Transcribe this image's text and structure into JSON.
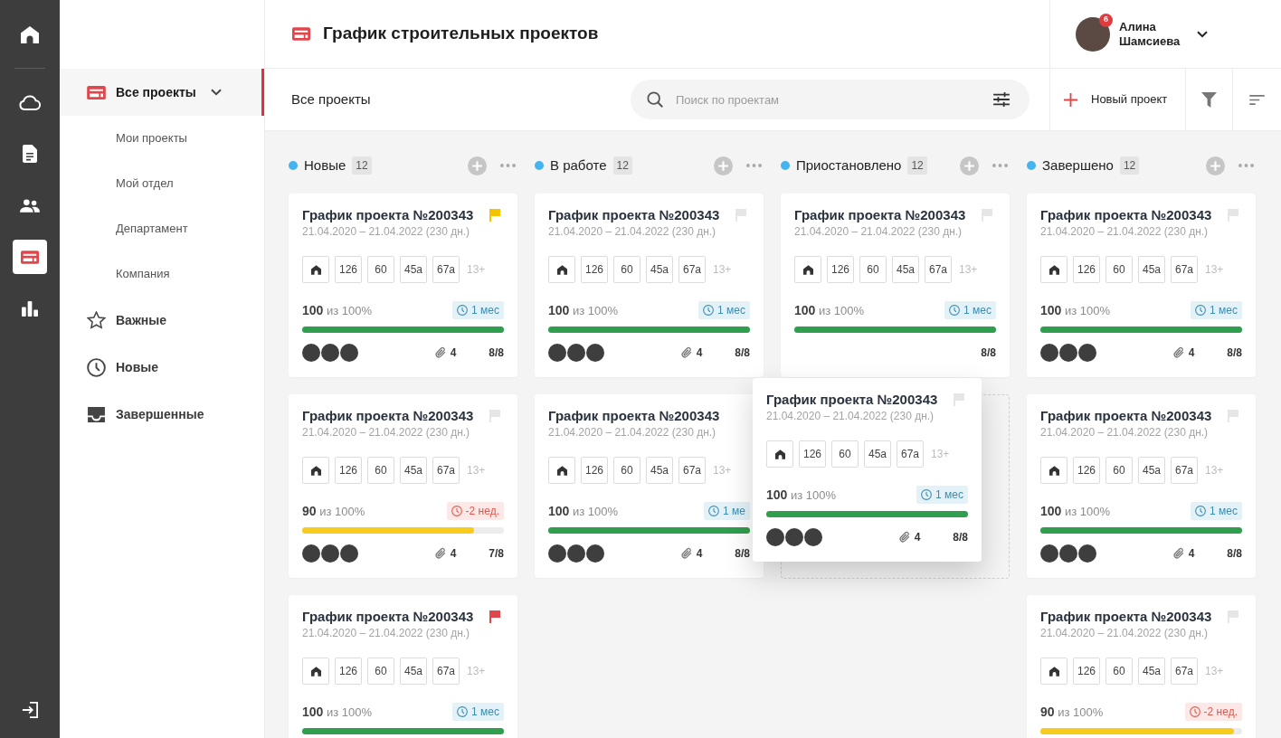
{
  "rail": {
    "items": [
      {
        "selected": false
      },
      {
        "selected": false
      },
      {
        "selected": false
      },
      {
        "selected": false
      },
      {
        "selected": true
      },
      {
        "selected": false
      }
    ]
  },
  "sidebar": {
    "items": [
      {
        "label": "Все проекты",
        "selected": true,
        "expanded": true,
        "children": [
          {
            "label": "Мои проекты",
            "selected": false
          },
          {
            "label": "Мой отдел",
            "selected": false
          },
          {
            "label": "Департамент",
            "selected": false
          },
          {
            "label": "Компания",
            "selected": false
          }
        ]
      },
      {
        "label": "Важные",
        "selected": false
      },
      {
        "label": "Новые",
        "selected": false
      },
      {
        "label": "Завершенные",
        "selected": false
      }
    ]
  },
  "header": {
    "title": "График строительных проектов",
    "user": {
      "name": "Алина Шамсиева",
      "notifications": "6"
    }
  },
  "toolbar": {
    "title": "Все проекты",
    "search": {
      "placeholder": "Поиск по проектам"
    },
    "new_project": "Новый проект"
  },
  "board": {
    "columns": [
      {
        "title": "Новые",
        "count": "12",
        "cards": [
          {
            "kind": "project",
            "title": "График проекта №200343",
            "dates": "21.04.2020 – 21.04.2022 (230 дн.)",
            "flag": {
              "color": "#f5c400"
            },
            "objects": [
              "126",
              "60",
              "45а",
              "67а"
            ],
            "more": "13+",
            "progress": "**100** из 100%",
            "due": {
              "text": "1 мес",
              "late": false
            },
            "level": 1,
            "members": [
              {
                "kind": "photo"
              },
              {
                "kind": "photo"
              },
              {
                "kind": "photo"
              }
            ],
            "attachments": "4",
            "tasks": "8/8"
          },
          {
            "kind": "project",
            "title": "График проекта №200343",
            "dates": "21.04.2020 – 21.04.2022 (230 дн.)",
            "flag": {
              "color": "#e6e6e6"
            },
            "objects": [
              "126",
              "60",
              "45а",
              "67а"
            ],
            "more": "13+",
            "progress": "**90** из 100%",
            "due": {
              "text": "-2 нед.",
              "late": true
            },
            "level": 0.85,
            "members": [
              {
                "kind": "photo"
              },
              {
                "kind": "photo"
              },
              {
                "kind": "photo"
              }
            ],
            "attachments": "4",
            "tasks": "7/8"
          },
          {
            "kind": "project",
            "title": "График проекта №200343",
            "dates": "21.04.2020 – 21.04.2022 (230 дн.)",
            "flag": {
              "color": "#e0474c"
            },
            "objects": [
              "126",
              "60",
              "45а",
              "67а"
            ],
            "more": "13+",
            "progress": "**100** из 100%",
            "due": {
              "text": "1 мес",
              "late": false
            },
            "level": 1
          }
        ]
      },
      {
        "title": "В работе",
        "count": "12",
        "cards": [
          {
            "kind": "project",
            "title": "График проекта №200343",
            "dates": "21.04.2020 – 21.04.2022 (230 дн.)",
            "flag": {
              "color": "#e6e6e6"
            },
            "objects": [
              "126",
              "60",
              "45а",
              "67а"
            ],
            "more": "13+",
            "progress": "**100** из 100%",
            "due": {
              "text": "1 мес",
              "late": false
            },
            "level": 1,
            "members": [
              {
                "kind": "photo"
              },
              {
                "kind": "photo"
              },
              {
                "kind": "photo"
              }
            ],
            "attachments": "4",
            "tasks": "8/8"
          },
          {
            "kind": "project",
            "title": "График проекта №200343",
            "dates": "21.04.2020 – 21.04.2022 (230 дн.)",
            "objects": [
              "126",
              "60",
              "45а",
              "67а"
            ],
            "more": "13+",
            "progress": "**100** из 100%",
            "due": {
              "text": "1 ме",
              "late": false
            },
            "level": 1,
            "members": [
              {
                "kind": "photo"
              },
              {
                "kind": "photo"
              },
              {
                "kind": "photo"
              }
            ],
            "attachments": "4",
            "tasks": "8/8"
          }
        ]
      },
      {
        "title": "Приостановлено",
        "count": "12",
        "cards": [
          {
            "kind": "project",
            "title": "График проекта №200343",
            "dates": "21.04.2020 – 21.04.2022 (230 дн.)",
            "flag": {
              "color": "#e6e6e6"
            },
            "objects": [
              "126",
              "60",
              "45а",
              "67а"
            ],
            "more": "13+",
            "progress": "**100** из 100%",
            "due": {
              "text": "1 мес",
              "late": false
            },
            "level": 1,
            "tasks": "8/8"
          },
          {
            "kind": "drop_zone"
          }
        ]
      },
      {
        "title": "Завершено",
        "count": "12",
        "cards": [
          {
            "kind": "project",
            "title": "График проекта №200343",
            "dates": "21.04.2020 – 21.04.2022 (230 дн.)",
            "flag": {
              "color": "#e6e6e6"
            },
            "objects": [
              "126",
              "60",
              "45а",
              "67а"
            ],
            "more": "13+",
            "progress": "**100** из 100%",
            "due": {
              "text": "1 мес",
              "late": false
            },
            "level": 1,
            "members": [
              {
                "kind": "photo"
              },
              {
                "kind": "photo"
              },
              {
                "kind": "photo"
              }
            ],
            "attachments": "4",
            "tasks": "8/8"
          },
          {
            "kind": "project",
            "title": "График проекта №200343",
            "dates": "21.04.2020 – 21.04.2022 (230 дн.)",
            "flag": {
              "color": "#e6e6e6"
            },
            "objects": [
              "126",
              "60",
              "45а",
              "67а"
            ],
            "more": "13+",
            "progress": "**100** из 100%",
            "due": {
              "text": "1 мес",
              "late": false
            },
            "level": 1,
            "members": [
              {
                "kind": "photo"
              },
              {
                "kind": "photo"
              },
              {
                "kind": "photo"
              }
            ],
            "attachments": "4",
            "tasks": "8/8"
          },
          {
            "kind": "project",
            "title": "График проекта №200343",
            "dates": "21.04.2020 – 21.04.2022 (230 дн.)",
            "flag": {
              "color": "#e6e6e6"
            },
            "objects": [
              "126",
              "60",
              "45а",
              "67а"
            ],
            "more": "13+",
            "progress": "**90** из 100%",
            "due": {
              "text": "-2 нед.",
              "late": true
            },
            "level": 0.96
          }
        ]
      }
    ],
    "dragged_card": {
      "kind": "project",
      "title": "График проекта №200343",
      "dates": "21.04.2020 – 21.04.2022 (230 дн.)",
      "flag": {
        "color": "#e6e6e6"
      },
      "objects": [
        "126",
        "60",
        "45а",
        "67а"
      ],
      "more": "13+",
      "progress": "**100** из 100%",
      "due": {
        "text": "1 мес",
        "late": false
      },
      "level": 1,
      "members": [
        {
          "kind": "photo"
        },
        {
          "kind": "photo"
        },
        {
          "kind": "photo"
        }
      ],
      "attachments": "4",
      "tasks": "8/8"
    }
  }
}
